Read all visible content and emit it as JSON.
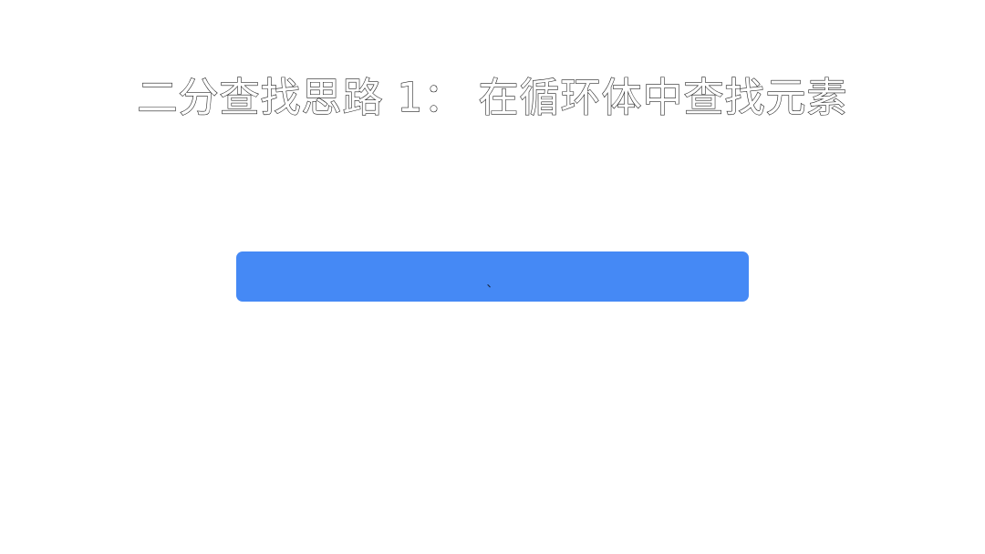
{
  "slide": {
    "title": "二分查找思路 1： 在循环体中查找元素",
    "bar": {
      "text": "、",
      "color": "#4589F5"
    }
  },
  "colors": {
    "background": "#FFFFFF",
    "title_outline": "#222222",
    "accent_bar": "#4589F5"
  }
}
